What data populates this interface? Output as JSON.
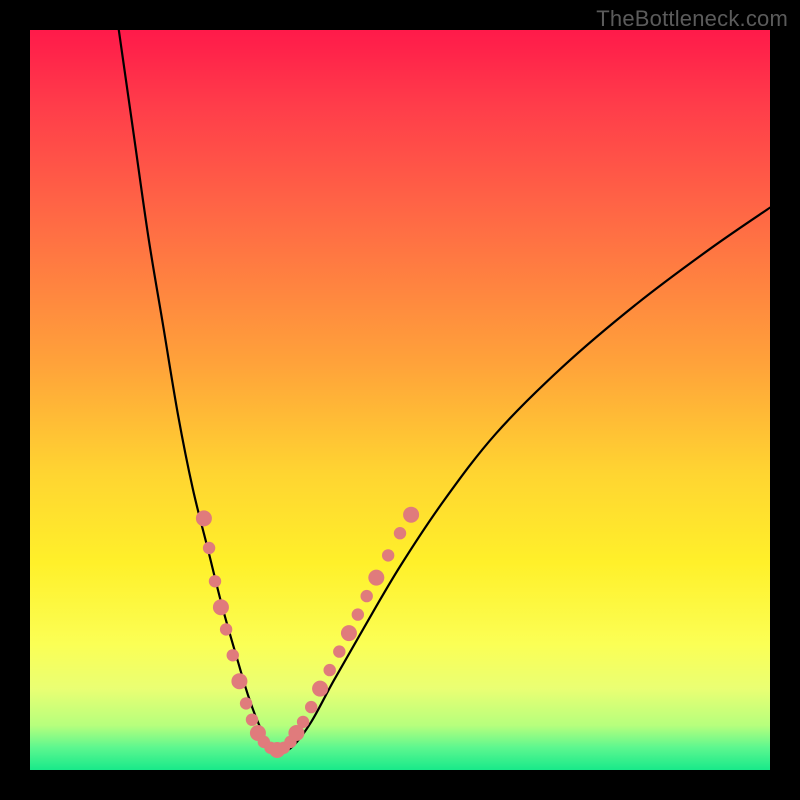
{
  "watermark": "TheBottleneck.com",
  "colors": {
    "background_frame": "#000000",
    "gradient_top": "#ff1a4a",
    "gradient_mid": "#ffd531",
    "gradient_bottom": "#18e98a",
    "curve": "#000000",
    "dots": "#e07b7c"
  },
  "chart_data": {
    "type": "line",
    "title": "",
    "xlabel": "",
    "ylabel": "",
    "xlim": [
      0,
      100
    ],
    "ylim": [
      0,
      100
    ],
    "note": "x and y are in percent of the plot area (origin top-left for rendering). The curve is a V-shaped bottleneck profile: steep descent on the left, flat minimum near x≈33, gentler rise on the right. Dots mark sample points clustered along both flanks of the valley near the bottom.",
    "series": [
      {
        "name": "bottleneck-curve",
        "x": [
          12,
          14,
          16,
          18,
          20,
          22,
          24,
          26,
          28,
          29.5,
          31,
          32.5,
          34,
          35.5,
          38,
          41,
          45,
          50,
          56,
          63,
          72,
          82,
          92,
          100
        ],
        "y": [
          0,
          14,
          28,
          40,
          52,
          62,
          70,
          78,
          85,
          90,
          94,
          96.8,
          97.4,
          96.8,
          93.5,
          88,
          81,
          72.5,
          63.5,
          54.5,
          45.5,
          37,
          29.5,
          24
        ]
      }
    ],
    "markers": {
      "name": "sample-dots",
      "points": [
        {
          "x": 23.5,
          "y": 66
        },
        {
          "x": 24.2,
          "y": 70
        },
        {
          "x": 25.0,
          "y": 74.5
        },
        {
          "x": 25.8,
          "y": 78
        },
        {
          "x": 26.5,
          "y": 81
        },
        {
          "x": 27.4,
          "y": 84.5
        },
        {
          "x": 28.3,
          "y": 88
        },
        {
          "x": 29.2,
          "y": 91
        },
        {
          "x": 30.0,
          "y": 93.2
        },
        {
          "x": 30.8,
          "y": 95
        },
        {
          "x": 31.6,
          "y": 96.2
        },
        {
          "x": 32.5,
          "y": 97.0
        },
        {
          "x": 33.4,
          "y": 97.3
        },
        {
          "x": 34.3,
          "y": 97.0
        },
        {
          "x": 35.2,
          "y": 96.2
        },
        {
          "x": 36.0,
          "y": 95.0
        },
        {
          "x": 36.9,
          "y": 93.5
        },
        {
          "x": 38.0,
          "y": 91.5
        },
        {
          "x": 39.2,
          "y": 89.0
        },
        {
          "x": 40.5,
          "y": 86.5
        },
        {
          "x": 41.8,
          "y": 84.0
        },
        {
          "x": 43.1,
          "y": 81.5
        },
        {
          "x": 44.3,
          "y": 79.0
        },
        {
          "x": 45.5,
          "y": 76.5
        },
        {
          "x": 46.8,
          "y": 74.0
        },
        {
          "x": 48.4,
          "y": 71.0
        },
        {
          "x": 50.0,
          "y": 68.0
        },
        {
          "x": 51.5,
          "y": 65.5
        }
      ]
    }
  }
}
